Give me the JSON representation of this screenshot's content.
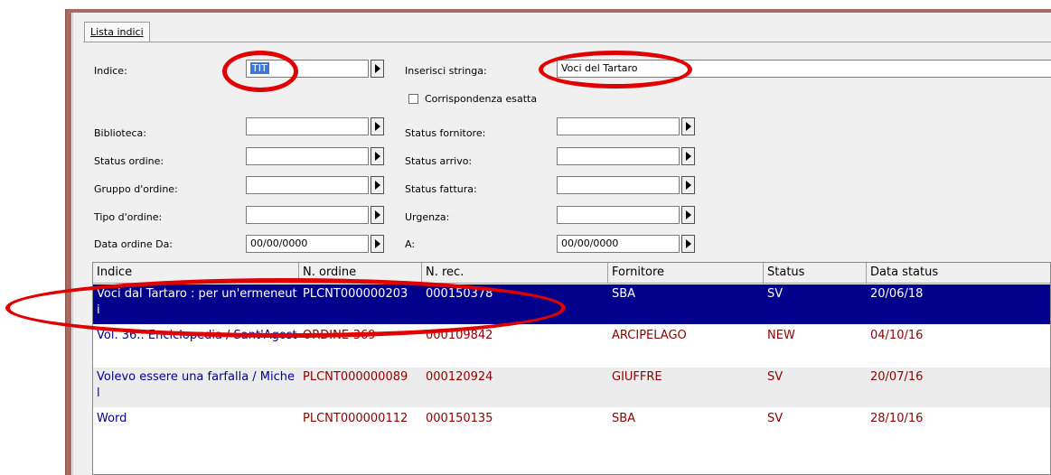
{
  "tab": {
    "label": "Lista indici"
  },
  "form": {
    "indice_label": "Indice:",
    "indice_value": "TIT",
    "inserisci_label": "Inserisci stringa:",
    "inserisci_value": "Voci del Tartaro",
    "corrispondenza_label": "Corrispondenza esatta",
    "biblioteca_label": "Biblioteca:",
    "status_ordine_label": "Status ordine:",
    "gruppo_label": "Gruppo d'ordine:",
    "tipo_label": "Tipo d'ordine:",
    "data_da_label": "Data ordine Da:",
    "data_da_value": "00/00/0000",
    "status_fornitore_label": "Status fornitore:",
    "status_arrivo_label": "Status arrivo:",
    "status_fattura_label": "Status fattura:",
    "urgenza_label": "Urgenza:",
    "a_label": "A:",
    "a_value": "00/00/0000"
  },
  "grid": {
    "columns": [
      "Indice",
      "N. ordine",
      "N. rec.",
      "Fornitore",
      "Status",
      "Data status"
    ],
    "rows": [
      [
        "Voci dal Tartaro : per un'ermeneuti",
        "PLCNT000000203",
        "000150378",
        "SBA",
        "SV",
        "20/06/18"
      ],
      [
        "Vol. 36.: Enciclopedia / Sant'Agost",
        "ORDINE-369",
        "000109842",
        "ARCIPELAGO",
        "NEW",
        "04/10/16"
      ],
      [
        "Volevo essere una farfalla / Michel",
        "PLCNT000000089",
        "000120924",
        "GIUFFRE",
        "SV",
        "20/07/16"
      ],
      [
        "Word",
        "PLCNT000000112",
        "000150135",
        "SBA",
        "SV",
        "28/10/16"
      ]
    ]
  },
  "colors": {
    "selected_row": "#00008b",
    "annotation": "#e00000",
    "title_text": "#00008b",
    "data_text": "#8b0000"
  }
}
